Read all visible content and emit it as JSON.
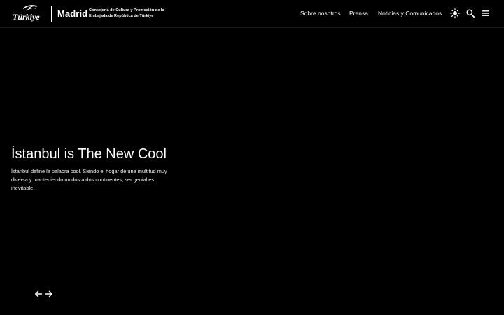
{
  "header": {
    "logo_text": "Türkiye",
    "city": "Madrid",
    "subtitle_line1": "Consejería de Cultura y Promoción de la",
    "subtitle_line2": "Embajada de República de Türkiye",
    "nav": [
      {
        "label": "Sobre nosotros"
      },
      {
        "label": "Prensa"
      },
      {
        "label": "Noticias y Comunicados"
      }
    ],
    "icons": {
      "theme": "sun-icon",
      "search": "search-icon",
      "menu": "hamburger-menu-icon"
    }
  },
  "hero": {
    "title": "İstanbul is The New Cool",
    "description": "İstanbul define la palabra cool. Siendo el hogar de una multitud muy diversa y manteniendo unidos a dos continentes, ser genial es inevitable.",
    "controls": {
      "prev": "arrow-left-icon",
      "next": "arrow-right-icon"
    }
  },
  "colors": {
    "background": "#000000",
    "text": "#ffffff"
  }
}
